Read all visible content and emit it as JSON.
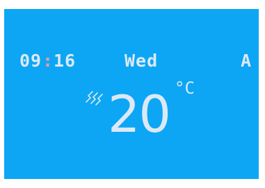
{
  "display": {
    "time_hours": "09",
    "time_separator": ":",
    "time_minutes": "16",
    "day": "Wed",
    "mode": "A",
    "temperature": "20",
    "unit": "°C",
    "heating_icon": "heat-waves-icon"
  },
  "colors": {
    "screen_background": "#0DA6F4",
    "text": "#DCE9F5",
    "separator_accent": "#F29AA8"
  }
}
